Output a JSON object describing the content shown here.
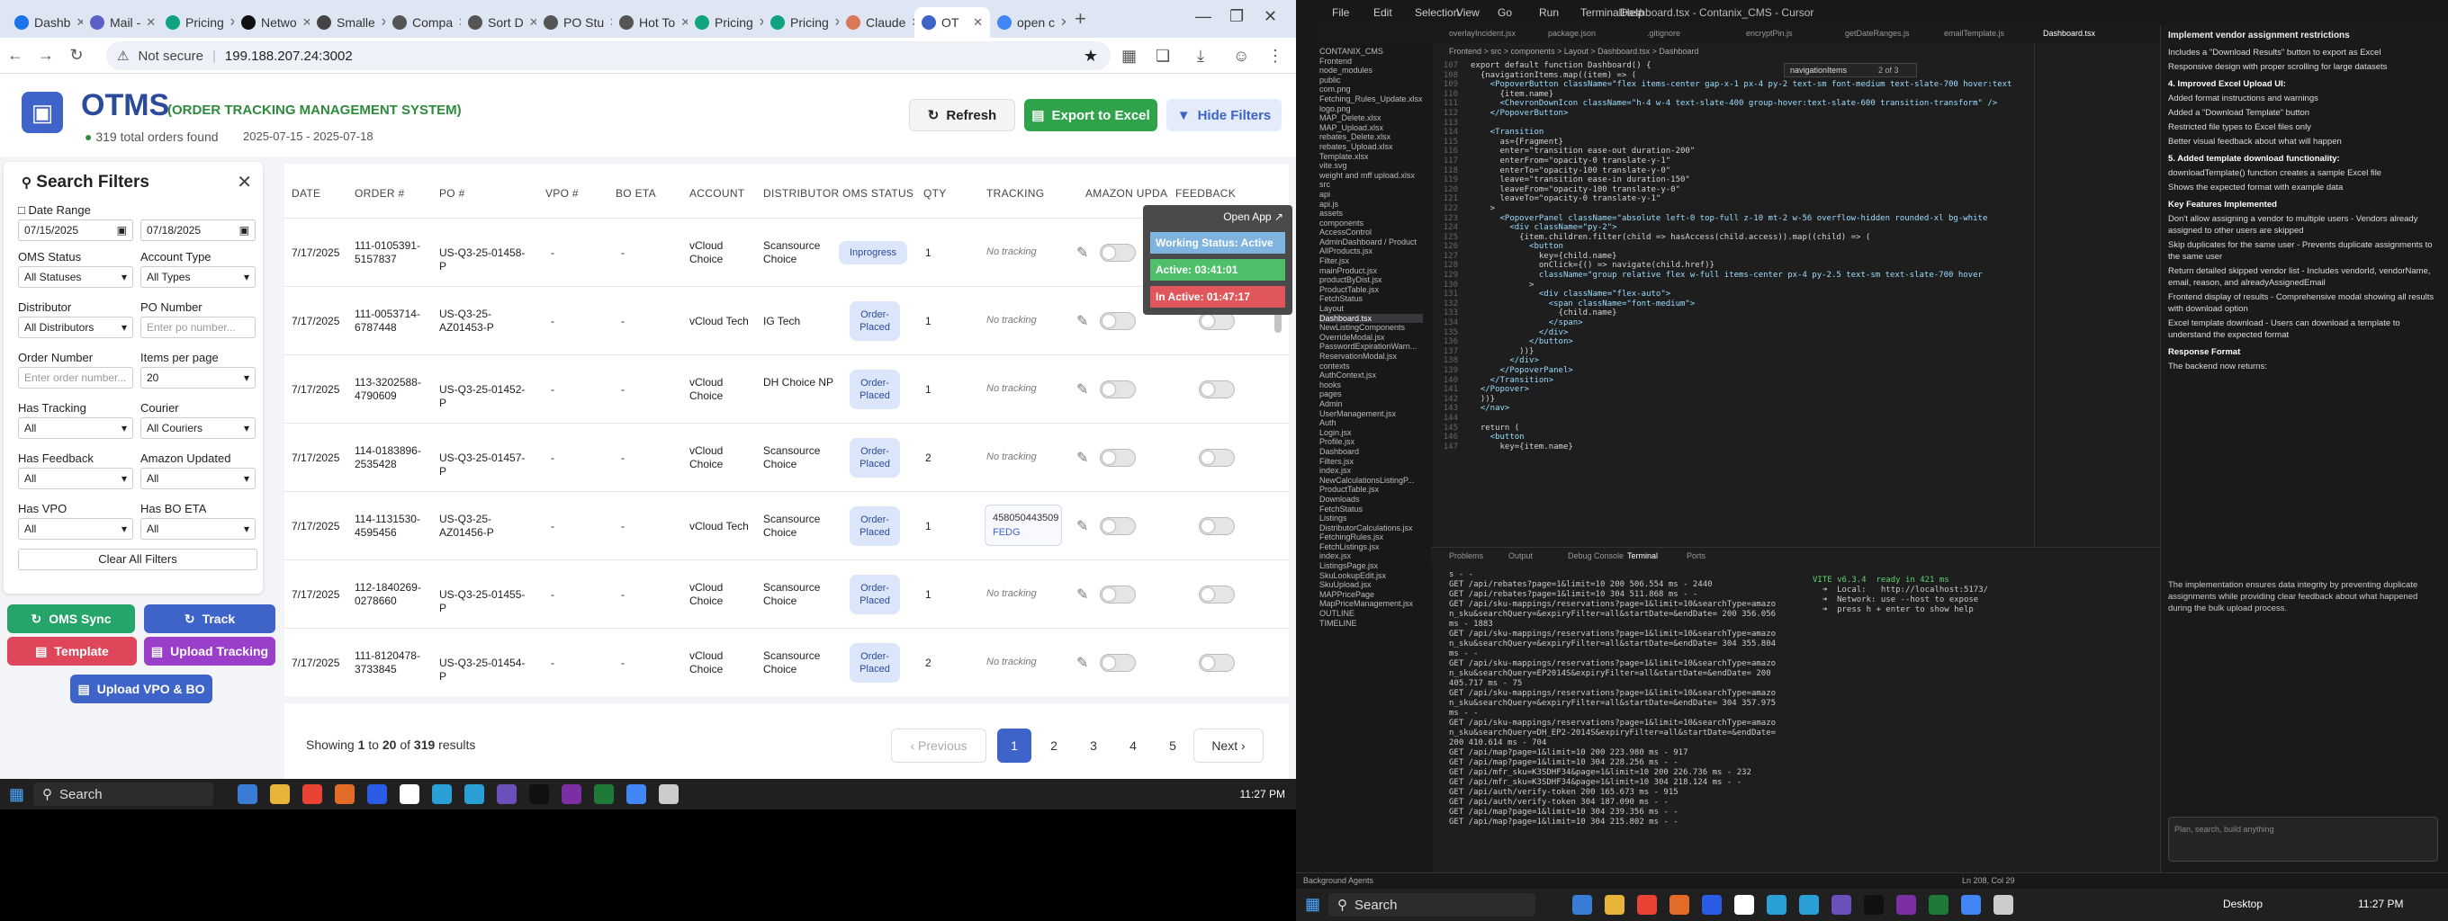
{
  "browser": {
    "tabs": [
      {
        "label": "Dashb",
        "color": "#1a73e8"
      },
      {
        "label": "Mail -",
        "color": "#5b5fc7"
      },
      {
        "label": "Pricing",
        "color": "#10a37f"
      },
      {
        "label": "Netwo",
        "color": "#111111"
      },
      {
        "label": "Smalle",
        "color": "#444444"
      },
      {
        "label": "Compa",
        "color": "#555555"
      },
      {
        "label": "Sort D",
        "color": "#555555"
      },
      {
        "label": "PO Stu",
        "color": "#555555"
      },
      {
        "label": "Hot To",
        "color": "#555555"
      },
      {
        "label": "Pricing",
        "color": "#10a37f"
      },
      {
        "label": "Pricing",
        "color": "#10a37f"
      },
      {
        "label": "Claude",
        "color": "#d97757"
      },
      {
        "label": "OT",
        "color": "#3e63c9"
      },
      {
        "label": "open c",
        "color": "#4285f4"
      }
    ],
    "not_secure": "Not secure",
    "url": "199.188.207.24:3002"
  },
  "app": {
    "title": "OTMS",
    "subtitle": "(ORDER TRACKING MANAGEMENT SYSTEM)",
    "orders_found": "319 total orders found",
    "date_range": "2025-07-15 - 2025-07-18",
    "refresh": "Refresh",
    "export": "Export to Excel",
    "hide_filters": "Hide Filters"
  },
  "filters": {
    "title": "Search Filters",
    "date_range_label": "Date Range",
    "date_from": "07/15/2025",
    "date_to": "07/18/2025",
    "oms_status_label": "OMS Status",
    "oms_status_value": "All Statuses",
    "account_type_label": "Account Type",
    "account_type_value": "All Types",
    "distributor_label": "Distributor",
    "distributor_value": "All Distributors",
    "po_number_label": "PO Number",
    "po_number_placeholder": "Enter po number...",
    "order_number_label": "Order Number",
    "order_number_placeholder": "Enter order number...",
    "items_per_page_label": "Items per page",
    "items_per_page_value": "20",
    "has_tracking_label": "Has Tracking",
    "has_tracking_value": "All",
    "courier_label": "Courier",
    "courier_value": "All Couriers",
    "has_feedback_label": "Has Feedback",
    "has_feedback_value": "All",
    "amazon_updated_label": "Amazon Updated",
    "amazon_updated_value": "All",
    "has_vpo_label": "Has VPO",
    "has_vpo_value": "All",
    "has_bo_eta_label": "Has BO ETA",
    "has_bo_eta_value": "All",
    "clear_all": "Clear All Filters"
  },
  "actions": {
    "oms_sync": "OMS Sync",
    "track": "Track",
    "template": "Template",
    "upload_tracking": "Upload Tracking",
    "upload_vpo": "Upload VPO & BO"
  },
  "table": {
    "headers": [
      "DATE",
      "ORDER #",
      "PO #",
      "VPO #",
      "BO ETA",
      "ACCOUNT",
      "DISTRIBUTOR",
      "OMS STATUS",
      "QTY",
      "TRACKING",
      "AMAZON UPDA",
      "FEEDBACK"
    ],
    "no_tracking": "No tracking",
    "rows": [
      {
        "date": "7/17/2025",
        "order": "111-0105391-5157837",
        "po": "US-Q3-25-01458-P",
        "vpo": "-",
        "bo": "-",
        "account": "vCloud Choice",
        "distributor": "Scansource Choice",
        "status": "Inprogress",
        "qty": "1",
        "tracking": "",
        "courier": ""
      },
      {
        "date": "7/17/2025",
        "order": "111-0053714-6787448",
        "po": "US-Q3-25-AZ01453-P",
        "vpo": "-",
        "bo": "-",
        "account": "vCloud Tech",
        "distributor": "IG Tech",
        "status": "Order-Placed",
        "qty": "1",
        "tracking": "",
        "courier": ""
      },
      {
        "date": "7/17/2025",
        "order": "113-3202588-4790609",
        "po": "US-Q3-25-01452-P",
        "vpo": "-",
        "bo": "-",
        "account": "vCloud Choice",
        "distributor": "DH Choice NP",
        "status": "Order-Placed",
        "qty": "1",
        "tracking": "",
        "courier": ""
      },
      {
        "date": "7/17/2025",
        "order": "114-0183896-2535428",
        "po": "US-Q3-25-01457-P",
        "vpo": "-",
        "bo": "-",
        "account": "vCloud Choice",
        "distributor": "Scansource Choice",
        "status": "Order-Placed",
        "qty": "2",
        "tracking": "",
        "courier": ""
      },
      {
        "date": "7/17/2025",
        "order": "114-1131530-4595456",
        "po": "US-Q3-25-AZ01456-P",
        "vpo": "-",
        "bo": "-",
        "account": "vCloud Tech",
        "distributor": "Scansource Choice",
        "status": "Order-Placed",
        "qty": "1",
        "tracking": "458050443509",
        "courier": "FEDG"
      },
      {
        "date": "7/17/2025",
        "order": "112-1840269-0278660",
        "po": "US-Q3-25-01455-P",
        "vpo": "-",
        "bo": "-",
        "account": "vCloud Choice",
        "distributor": "Scansource Choice",
        "status": "Order-Placed",
        "qty": "1",
        "tracking": "",
        "courier": ""
      },
      {
        "date": "7/17/2025",
        "order": "111-8120478-3733845",
        "po": "US-Q3-25-01454-P",
        "vpo": "-",
        "bo": "-",
        "account": "vCloud Choice",
        "distributor": "Scansource Choice",
        "status": "Order-Placed",
        "qty": "2",
        "tracking": "",
        "courier": ""
      }
    ]
  },
  "overlay": {
    "open_app": "Open App",
    "working_status": "Working Status: Active",
    "active": "Active: 03:41:01",
    "inactive": "In Active: 01:47:17"
  },
  "pagination": {
    "showing_prefix": "Showing",
    "from": "1",
    "to_word": "to",
    "to": "20",
    "of_word": "of",
    "total": "319",
    "results_word": "results",
    "previous": "Previous",
    "pages": [
      "1",
      "2",
      "3",
      "4",
      "5"
    ],
    "next": "Next"
  },
  "taskbar_left": {
    "search": "Search",
    "time": "11:27 PM"
  },
  "editor": {
    "title": "Dashboard.tsx - Contanix_CMS - Cursor",
    "menu": [
      "File",
      "Edit",
      "Selection",
      "View",
      "Go",
      "Run",
      "Terminal",
      "Help"
    ],
    "tabs": [
      "overlayIncident.jsx",
      "package.json",
      ".gitignore",
      "encryptPin.js",
      "getDateRanges.js",
      "emailTemplate.js",
      "Dashboard.tsx"
    ],
    "breadcrumb": "Frontend > src > components > Layout > Dashboard.tsx > Dashboard",
    "find_text": "navigationItems",
    "find_count": "2 of 3",
    "code_lines": [
      "export default function Dashboard() {",
      "  {navigationItems.map((item) => (",
      "    <PopoverButton className=\"flex items-center gap-x-1 px-4 py-2 text-sm font-medium text-slate-700 hover:text",
      "      {item.name}",
      "      <ChevronDownIcon className=\"h-4 w-4 text-slate-400 group-hover:text-slate-600 transition-transform\" />",
      "    </PopoverButton>",
      "",
      "    <Transition",
      "      as={Fragment}",
      "      enter=\"transition ease-out duration-200\"",
      "      enterFrom=\"opacity-0 translate-y-1\"",
      "      enterTo=\"opacity-100 translate-y-0\"",
      "      leave=\"transition ease-in duration-150\"",
      "      leaveFrom=\"opacity-100 translate-y-0\"",
      "      leaveTo=\"opacity-0 translate-y-1\"",
      "    >",
      "      <PopoverPanel className=\"absolute left-0 top-full z-10 mt-2 w-56 overflow-hidden rounded-xl bg-white",
      "        <div className=\"py-2\">",
      "          {item.children.filter(child => hasAccess(child.access)).map((child) => (",
      "            <button",
      "              key={child.name}",
      "              onClick={() => navigate(child.href)}",
      "              className=\"group relative flex w-full items-center px-4 py-2.5 text-sm text-slate-700 hover",
      "            >",
      "              <div className=\"flex-auto\">",
      "                <span className=\"font-medium\">",
      "                  {child.name}",
      "                </span>",
      "              </div>",
      "            </button>",
      "          ))}",
      "        </div>",
      "      </PopoverPanel>",
      "    </Transition>",
      "  </Popover>",
      "  ))}",
      "  </nav>",
      "",
      "  return (",
      "    <button",
      "      key={item.name}"
    ],
    "terminal_tabs": [
      "Problems",
      "Output",
      "Debug Console",
      "Terminal",
      "Ports"
    ],
    "terminal_lines": [
      "s - -",
      "GET /api/rebates?page=1&limit=10 200 506.554 ms - 2440",
      "GET /api/rebates?page=1&limit=10 304 511.868 ms - -",
      "GET /api/sku-mappings/reservations?page=1&limit=10&searchType=amazo",
      "n_sku&searchQuery=&expiryFilter=all&startDate=&endDate= 200 356.056",
      "ms - 1883",
      "GET /api/sku-mappings/reservations?page=1&limit=10&searchType=amazo",
      "n_sku&searchQuery=&expiryFilter=all&startDate=&endDate= 304 355.804",
      "ms - -",
      "GET /api/sku-mappings/reservations?page=1&limit=10&searchType=amazo",
      "n_sku&searchQuery=EP2014S&expiryFilter=all&startDate=&endDate= 200",
      "405.717 ms - 75",
      "GET /api/sku-mappings/reservations?page=1&limit=10&searchType=amazo",
      "n_sku&searchQuery=&expiryFilter=all&startDate=&endDate= 304 357.975",
      "ms - -",
      "GET /api/sku-mappings/reservations?page=1&limit=10&searchType=amazo",
      "n_sku&searchQuery=DH_EP2-2014S&expiryFilter=all&startDate=&endDate=",
      "200 410.614 ms - 704",
      "GET /api/map?page=1&limit=10 200 223.980 ms - 917",
      "GET /api/map?page=1&limit=10 304 228.256 ms - -",
      "GET /api/mfr_sku=K3SDHF34&page=1&limit=10 200 226.736 ms - 232",
      "GET /api/mfr_sku=K3SDHF34&page=1&limit=10 304 218.124 ms - -",
      "GET /api/auth/verify-token 200 165.673 ms - 915",
      "GET /api/auth/verify-token 304 187.090 ms - -",
      "GET /api/map?page=1&limit=10 304 239.356 ms - -",
      "GET /api/map?page=1&limit=10 304 215.802 ms - -"
    ],
    "vite_lines": [
      "VITE v6.3.4  ready in 421 ms",
      "",
      "  ➜  Local:   http://localhost:5173/",
      "  ➜  Network: use --host to expose",
      "  ➜  press h + enter to show help"
    ],
    "tree": [
      "CONTANIX_CMS",
      "Frontend",
      "node_modules",
      "public",
      "com.png",
      "Fetching_Rules_Update.xlsx",
      "logo.png",
      "MAP_Delete.xlsx",
      "MAP_Upload.xlsx",
      "rebates_Delete.xlsx",
      "rebates_Upload.xlsx",
      "Template.xlsx",
      "vite.svg",
      "weight and mff upload.xlsx",
      "src",
      "api",
      "api.js",
      "assets",
      "components",
      "AccessControl",
      "AdminDashboard / Product",
      "AllProducts.jsx",
      "Filter.jsx",
      "mainProduct.jsx",
      "productByDist.jsx",
      "ProductTable.jsx",
      "FetchStatus",
      "Layout",
      "Dashboard.tsx",
      "NewListingComponents",
      "OverrideModal.jsx",
      "PasswordExpirationWarn...",
      "ReservationModal.jsx",
      "contexts",
      "AuthContext.jsx",
      "hooks",
      "pages",
      "Admin",
      "UserManagement.jsx",
      "Auth",
      "Login.jsx",
      "Profile.jsx",
      "Dashboard",
      "Filters.jsx",
      "index.jsx",
      "NewCalculationsListingP...",
      "ProductTable.jsx",
      "Downloads",
      "FetchStatus",
      "Listings",
      "DistributorCalculations.jsx",
      "FetchingRules.jsx",
      "FetchListings.jsx",
      "index.jsx",
      "ListingsPage.jsx",
      "SkuLookupEdit.jsx",
      "SkuUpload.jsx",
      "MAPPricePage",
      "MapPriceManagement.jsx",
      "OUTLINE",
      "TIMELINE"
    ],
    "chat_title": "Implement vendor assignment restrictions",
    "chat_lines": [
      "Includes a \"Download Results\" button to export as Excel",
      "Responsive design with proper scrolling for large datasets",
      "4. Improved Excel Upload UI:",
      "Added format instructions and warnings",
      "Added a \"Download Template\" button",
      "Restricted file types to Excel files only",
      "Better visual feedback about what will happen",
      "5. Added template download functionality:",
      "downloadTemplate() function creates a sample Excel file",
      "Shows the expected format with example data",
      "Key Features Implemented",
      "Don't allow assigning a vendor to multiple users - Vendors already assigned to other users are skipped",
      "Skip duplicates for the same user - Prevents duplicate assignments to the same user",
      "Return detailed skipped vendor list - Includes vendorId, vendorName, email, reason, and alreadyAssignedEmail",
      "Frontend display of results - Comprehensive modal showing all results with download option",
      "Excel template download - Users can download a template to understand the expected format",
      "Response Format",
      "The backend now returns:"
    ],
    "chat_footer": "The implementation ensures data integrity by preventing duplicate assignments while providing clear feedback about what happened during the bulk upload process.",
    "chat_input_placeholder": "Plan, search, build anything",
    "status_left": "Background Agents",
    "status_right": "Ln 208, Col 29",
    "rtaskbar_search": "Search",
    "rtaskbar_desktop": "Desktop",
    "rtaskbar_time": "11:27 PM"
  }
}
